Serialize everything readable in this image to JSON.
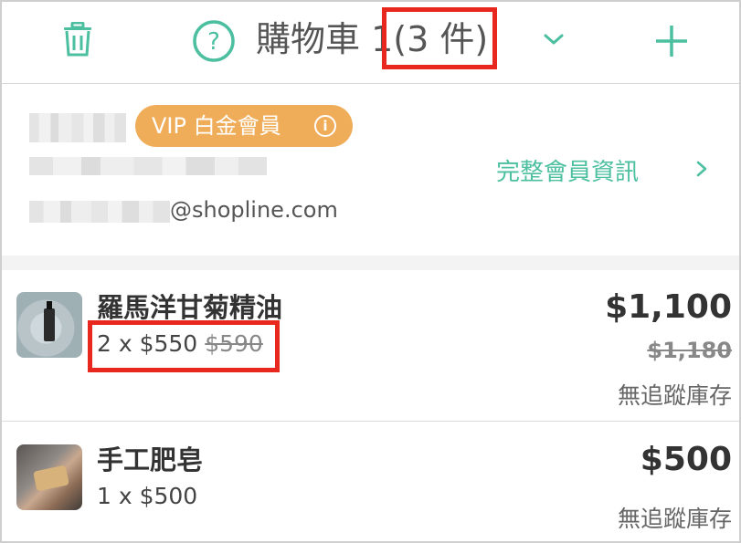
{
  "header": {
    "title": "購物車 1",
    "count": "(3 件)"
  },
  "member": {
    "vip_label": "VIP 白金會員",
    "vip_info_icon": "i",
    "full_info_link": "完整會員資訊",
    "email_suffix": "@shopline.com"
  },
  "items": [
    {
      "name": "羅馬洋甘菊精油",
      "qty_price": "2 x $550",
      "orig_unit_price": "$590",
      "total": "$1,100",
      "orig_total": "$1,180",
      "stock": "無追蹤庫存"
    },
    {
      "name": "手工肥皂",
      "qty_price": "1 x $500",
      "total": "$500",
      "stock": "無追蹤庫存"
    }
  ],
  "colors": {
    "accent": "#4bbf9f",
    "vip": "#f0ad59",
    "highlight": "#e8281e"
  },
  "icons": [
    "trash-icon",
    "help-icon",
    "chevron-down-icon",
    "plus-icon",
    "info-icon",
    "chevron-right-icon"
  ]
}
